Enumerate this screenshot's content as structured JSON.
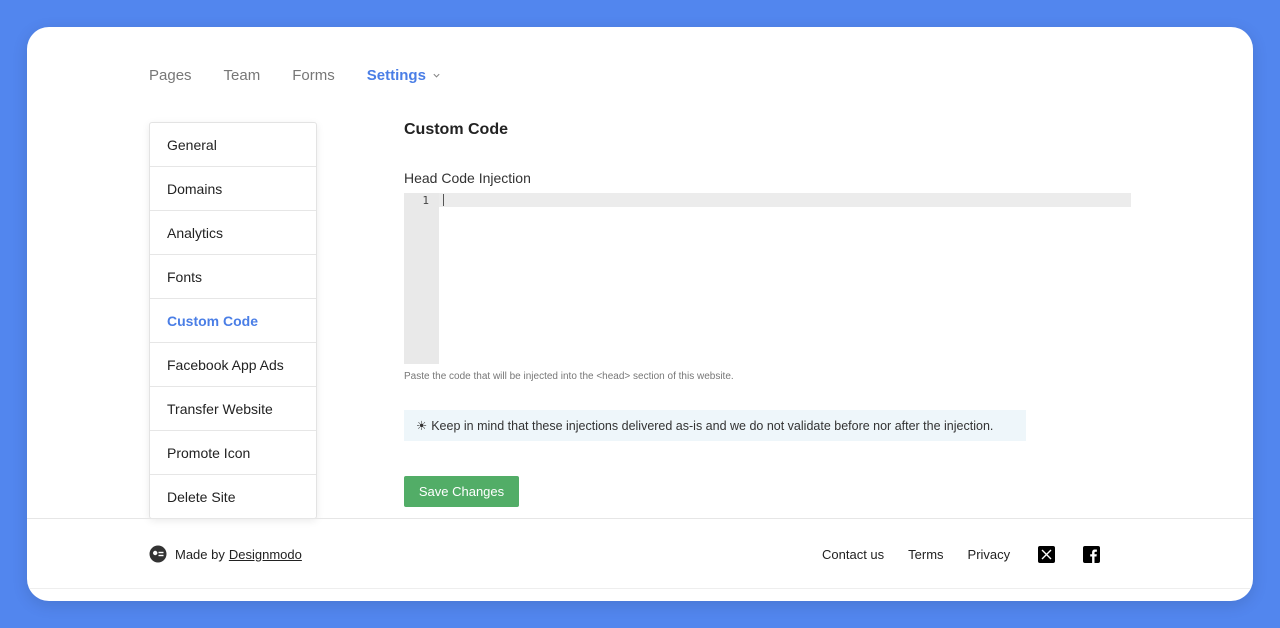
{
  "topnav": {
    "items": [
      "Pages",
      "Team",
      "Forms"
    ],
    "active": "Settings"
  },
  "sidebar": {
    "items": [
      {
        "label": "General"
      },
      {
        "label": "Domains"
      },
      {
        "label": "Analytics"
      },
      {
        "label": "Fonts"
      },
      {
        "label": "Custom Code",
        "active": true
      },
      {
        "label": "Facebook App Ads"
      },
      {
        "label": "Transfer Website"
      },
      {
        "label": "Promote Icon"
      },
      {
        "label": "Delete Site"
      }
    ]
  },
  "main": {
    "title": "Custom Code",
    "field_label": "Head Code Injection",
    "line_number": "1",
    "helper": "Paste the code that will be injected into the <head> section of this website.",
    "notice_icon": "☀",
    "notice": "Keep in mind that these injections delivered as-is and we do not validate before nor after the injection.",
    "save_label": "Save Changes"
  },
  "footer": {
    "made_by": "Made by",
    "brand": "Designmodo",
    "links": [
      "Contact us",
      "Terms",
      "Privacy"
    ],
    "social_icons": [
      "x-icon",
      "facebook-icon"
    ]
  },
  "colors": {
    "background": "#5286ee",
    "accent": "#4a7ee6",
    "save_button": "#52ad67",
    "notice_bg": "#eef6fa"
  }
}
